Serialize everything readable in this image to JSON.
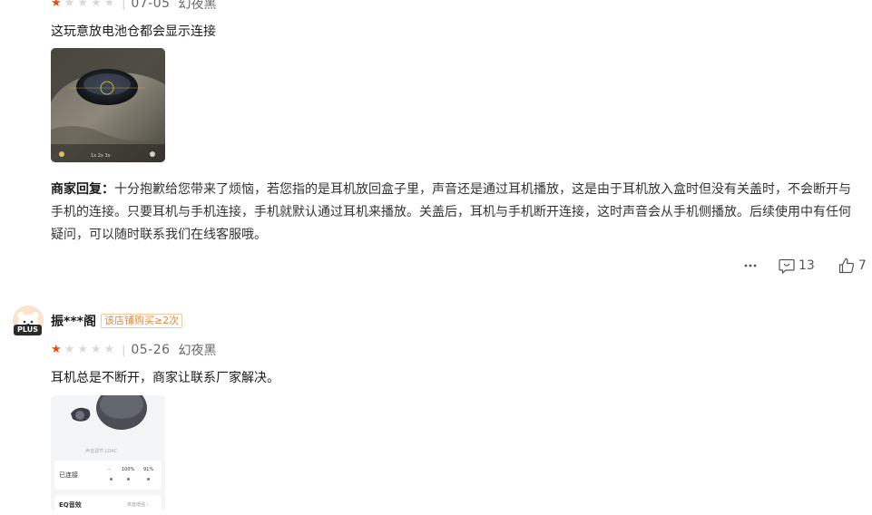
{
  "review1": {
    "rating": 1,
    "date": "07-05",
    "sku": "幻夜黑",
    "text": "这玩意放电池仓都会显示连接",
    "reply_label": "商家回复：",
    "reply_text": "十分抱歉给您带来了烦恼，若您指的是耳机放回盒子里，声音还是通过耳机播放，这是由于耳机放入盒时但没有关盖时，不会断开与手机的连接。只要耳机与手机连接，手机就默认通过耳机来播放。关盖后，耳机与手机断开连接，这时声音会从手机侧播放。后续使用中有任何疑问，可以随时联系我们在线客服哦。",
    "comment_count": "13",
    "like_count": "7"
  },
  "review2": {
    "nickname": "振***阁",
    "badge": "PLUS",
    "buyer_tag": "该店铺购买≥2次",
    "rating": 1,
    "date": "05-26",
    "sku": "幻夜黑",
    "text": "耳机总是不断开，商家让联系厂家解决。",
    "screenshot": {
      "status_label": "已连接",
      "dash": "--",
      "left_pct": "100%",
      "right_pct": "91%",
      "eq_label": "EQ音效",
      "eq_value": "高音增强 ›",
      "small_caption": "声音调节  LDAC"
    }
  },
  "icons": {
    "more": "more-icon",
    "comment": "comment-icon",
    "like": "thumbs-up-icon"
  },
  "colors": {
    "star_on": "#ff4400",
    "star_off": "#d9d9d9",
    "tag_text": "#e08a3c"
  }
}
